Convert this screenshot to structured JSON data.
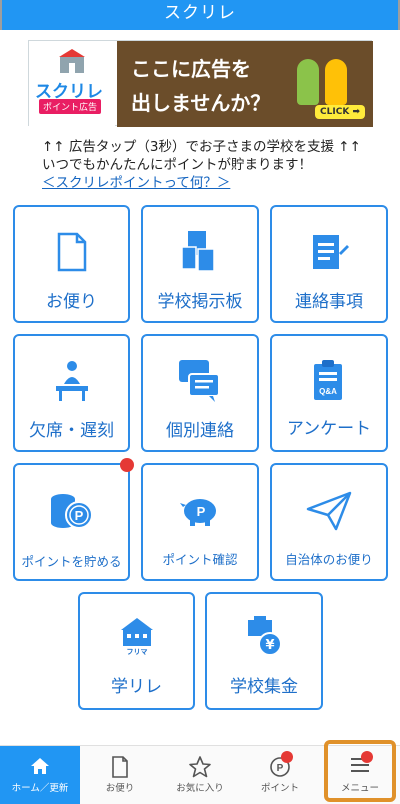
{
  "header": {
    "title": "スクリレ"
  },
  "ad": {
    "logo_text": "スクリレ",
    "logo_sub": "ポイント広告",
    "line1": "ここに広告を",
    "line2": "出しませんか？",
    "click": "CLICK ➡"
  },
  "notice": {
    "line1": "↑↑ 広告タップ（3秒）でお子さまの学校を支援 ↑↑",
    "line2": "いつでもかんたんにポイントが貯まります！",
    "link": "＜スクリレポイントって何？＞"
  },
  "tiles": {
    "otayori": "お便り",
    "keijiban": "学校掲示板",
    "renraku": "連絡事項",
    "kesseki": "欠席・遅刻",
    "kobetsu": "個別連絡",
    "enquete": "アンケート",
    "point_save": "ポイントを貯める",
    "point_check": "ポイント確認",
    "jichitai": "自治体のお便り",
    "gakurire": "学リレ",
    "gakurire_badge": "フリマ",
    "shukin": "学校集金",
    "qa_badge": "Q&A",
    "p_mark": "P",
    "yen_mark": "¥"
  },
  "tabbar": {
    "home": "ホーム／更新",
    "otayori": "お便り",
    "favorites": "お気に入り",
    "point": "ポイント",
    "menu": "メニュー"
  },
  "colors": {
    "primary": "#2196f3",
    "tile_border": "#2d8ce8",
    "tile_text": "#1e6fc9",
    "badge": "#e53935",
    "highlight": "#e0912a"
  }
}
